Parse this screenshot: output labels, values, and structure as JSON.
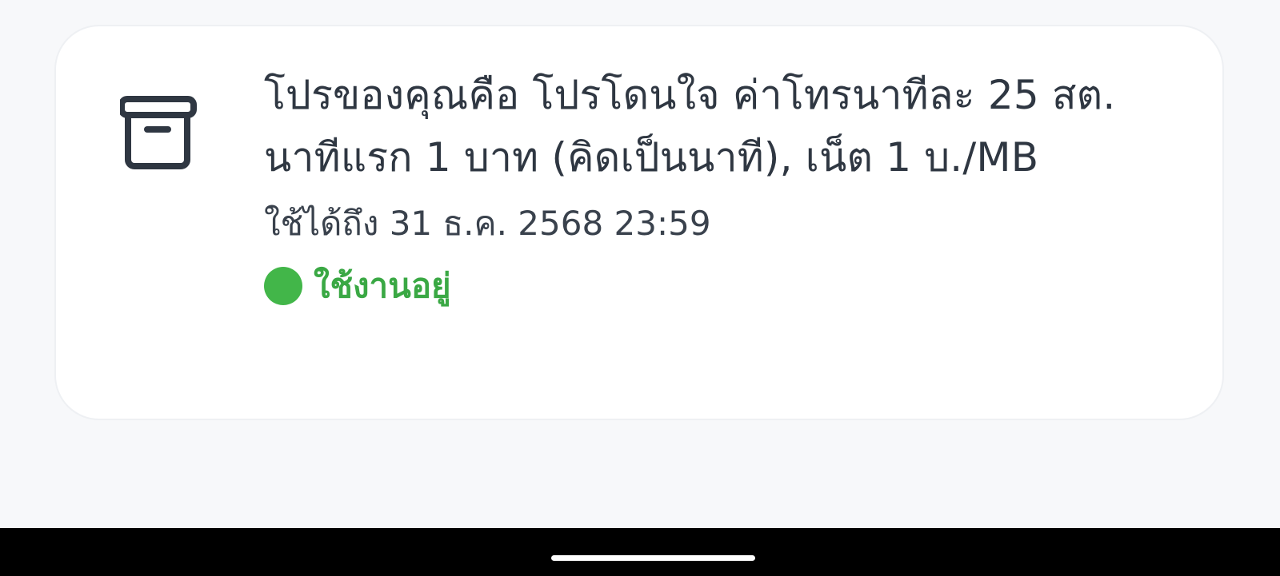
{
  "promo_card": {
    "icon": "archive-box-icon",
    "title": "โปรของคุณคือ โปรโดนใจ ค่าโทรนาทีละ 25 สต. นาทีแรก 1 บาท (คิดเป็นนาที), เน็ต 1 บ./MB",
    "expiry": "ใช้ได้ถึง 31 ธ.ค. 2568 23:59",
    "status_label": "ใช้งานอยู่",
    "status_color": "#42b649"
  },
  "colors": {
    "background": "#f7f8fa",
    "card": "#ffffff",
    "text_primary": "#2f3742",
    "status_text": "#3aa844",
    "nav_bar": "#000000"
  }
}
